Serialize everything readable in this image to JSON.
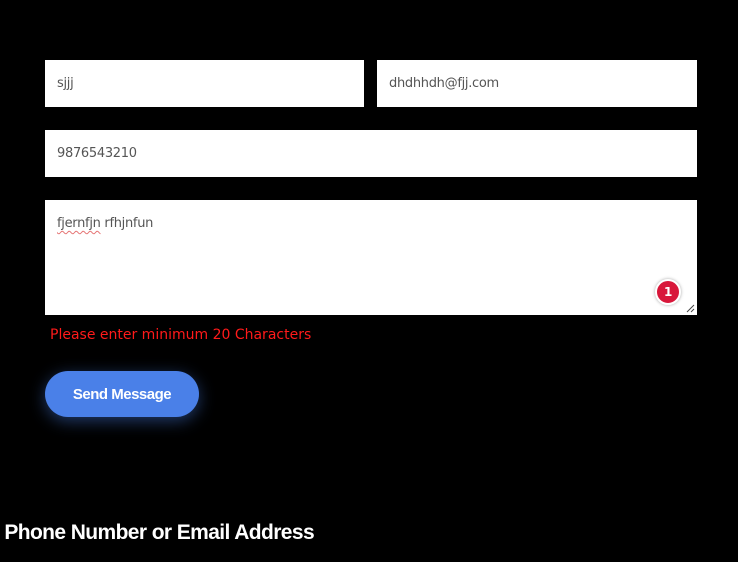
{
  "form": {
    "name_value": "sjjj",
    "email_value": "dhdhhdh@fjj.com",
    "phone_value": "9876543210",
    "message_word1": "fjernfjn",
    "message_word2": " rfhjnfun",
    "notification_count": "1",
    "error_message": "Please enter minimum 20 Characters",
    "submit_label": "Send Message"
  },
  "section": {
    "heading": "y Phone Number or Email Address"
  },
  "colors": {
    "background": "#000000",
    "field_background": "#ffffff",
    "error": "#ff1a1a",
    "button": "#4a80e8",
    "badge": "#d8173a"
  },
  "icons": {
    "resize": "resize-grip-icon",
    "badge": "grammar-notification-badge"
  }
}
